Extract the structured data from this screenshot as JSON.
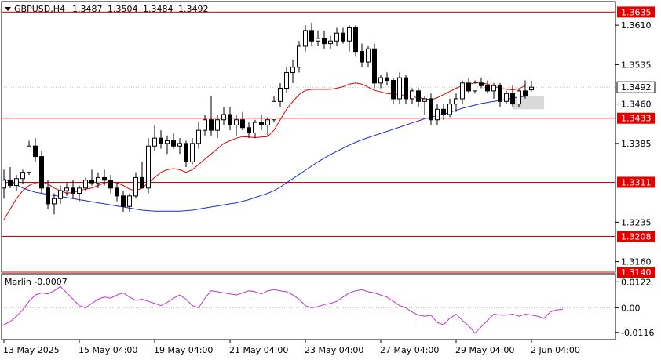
{
  "chart_data": [
    {
      "type": "candlestick",
      "symbol_header": "GBPUSD,H4",
      "ohlc_readout": [
        "1.3487",
        "1.3504",
        "1.3484",
        "1.3492"
      ],
      "y_axis_ticks": [
        "1.3610",
        "1.3535",
        "1.3460",
        "1.3385",
        "1.3235",
        "1.3160"
      ],
      "ylim": [
        1.314,
        1.3655
      ],
      "x_axis_ticks": [
        "13 May 2025",
        "15 May 04:00",
        "19 May 04:00",
        "21 May 04:00",
        "23 May 04:00",
        "27 May 04:00",
        "29 May 04:00",
        "2 Jun 04:00"
      ],
      "current_price": {
        "value": 1.3492,
        "label": "1.3492"
      },
      "horizontal_levels": [
        {
          "value": 1.3635,
          "label": "1.3635"
        },
        {
          "value": 1.3433,
          "label": "1.3433"
        },
        {
          "value": 1.3311,
          "label": "1.3311"
        },
        {
          "value": 1.3208,
          "label": "1.3208"
        },
        {
          "value": 1.314,
          "label": "1.3140"
        }
      ],
      "colors": {
        "levels": "#e00000",
        "fast_ma": "#e00000",
        "slow_ma": "#1a2ccc",
        "oscillator": "#bb33cc",
        "zone": "#d9d9d9"
      },
      "candles": [
        [
          1.33,
          1.3335,
          1.328,
          1.3315
        ],
        [
          1.3315,
          1.334,
          1.33,
          1.3305
        ],
        [
          1.3305,
          1.3325,
          1.3295,
          1.3318
        ],
        [
          1.3318,
          1.3335,
          1.3308,
          1.333
        ],
        [
          1.333,
          1.339,
          1.3325,
          1.338
        ],
        [
          1.338,
          1.3395,
          1.335,
          1.336
        ],
        [
          1.336,
          1.337,
          1.329,
          1.33
        ],
        [
          1.33,
          1.3315,
          1.326,
          1.327
        ],
        [
          1.327,
          1.329,
          1.325,
          1.328
        ],
        [
          1.328,
          1.3305,
          1.327,
          1.3295
        ],
        [
          1.3295,
          1.331,
          1.3285,
          1.33
        ],
        [
          1.33,
          1.3315,
          1.328,
          1.329
        ],
        [
          1.329,
          1.3305,
          1.3275,
          1.33
        ],
        [
          1.33,
          1.332,
          1.3295,
          1.3315
        ],
        [
          1.3315,
          1.3335,
          1.3305,
          1.331
        ],
        [
          1.331,
          1.333,
          1.33,
          1.332
        ],
        [
          1.332,
          1.3335,
          1.3305,
          1.3315
        ],
        [
          1.3315,
          1.3325,
          1.329,
          1.33
        ],
        [
          1.33,
          1.331,
          1.3275,
          1.3285
        ],
        [
          1.3285,
          1.3295,
          1.3255,
          1.3265
        ],
        [
          1.3265,
          1.329,
          1.3255,
          1.3285
        ],
        [
          1.3285,
          1.333,
          1.328,
          1.332
        ],
        [
          1.332,
          1.335,
          1.331,
          1.33
        ],
        [
          1.33,
          1.3395,
          1.329,
          1.338
        ],
        [
          1.338,
          1.342,
          1.337,
          1.3395
        ],
        [
          1.3395,
          1.341,
          1.3375,
          1.3385
        ],
        [
          1.3385,
          1.34,
          1.3365,
          1.339
        ],
        [
          1.339,
          1.3405,
          1.3375,
          1.338
        ],
        [
          1.338,
          1.3395,
          1.3365,
          1.3385
        ],
        [
          1.3385,
          1.339,
          1.334,
          1.335
        ],
        [
          1.335,
          1.3395,
          1.3345,
          1.3385
        ],
        [
          1.3385,
          1.3425,
          1.3375,
          1.341
        ],
        [
          1.341,
          1.344,
          1.34,
          1.343
        ],
        [
          1.343,
          1.3475,
          1.34,
          1.341
        ],
        [
          1.341,
          1.344,
          1.3395,
          1.343
        ],
        [
          1.343,
          1.3455,
          1.342,
          1.344
        ],
        [
          1.344,
          1.3455,
          1.341,
          1.342
        ],
        [
          1.342,
          1.344,
          1.34,
          1.343
        ],
        [
          1.343,
          1.3445,
          1.341,
          1.3415
        ],
        [
          1.3415,
          1.3425,
          1.3395,
          1.3405
        ],
        [
          1.3405,
          1.343,
          1.3395,
          1.3425
        ],
        [
          1.3425,
          1.344,
          1.341,
          1.342
        ],
        [
          1.342,
          1.3435,
          1.34,
          1.343
        ],
        [
          1.343,
          1.3475,
          1.3425,
          1.3465
        ],
        [
          1.3465,
          1.35,
          1.3455,
          1.349
        ],
        [
          1.349,
          1.353,
          1.348,
          1.352
        ],
        [
          1.352,
          1.3545,
          1.35,
          1.353
        ],
        [
          1.353,
          1.358,
          1.352,
          1.357
        ],
        [
          1.357,
          1.361,
          1.356,
          1.36
        ],
        [
          1.36,
          1.3615,
          1.357,
          1.358
        ],
        [
          1.358,
          1.36,
          1.357,
          1.3585
        ],
        [
          1.3585,
          1.36,
          1.3565,
          1.3575
        ],
        [
          1.3575,
          1.359,
          1.3565,
          1.358
        ],
        [
          1.358,
          1.3605,
          1.357,
          1.3595
        ],
        [
          1.3595,
          1.3605,
          1.3575,
          1.358
        ],
        [
          1.358,
          1.361,
          1.356,
          1.3605
        ],
        [
          1.3605,
          1.361,
          1.355,
          1.356
        ],
        [
          1.356,
          1.3575,
          1.353,
          1.354
        ],
        [
          1.354,
          1.357,
          1.353,
          1.3565
        ],
        [
          1.3565,
          1.3575,
          1.349,
          1.35
        ],
        [
          1.35,
          1.3515,
          1.349,
          1.351
        ],
        [
          1.351,
          1.352,
          1.3495,
          1.3505
        ],
        [
          1.3505,
          1.351,
          1.346,
          1.347
        ],
        [
          1.347,
          1.352,
          1.346,
          1.351
        ],
        [
          1.351,
          1.3515,
          1.346,
          1.347
        ],
        [
          1.347,
          1.349,
          1.346,
          1.3485
        ],
        [
          1.3485,
          1.349,
          1.3455,
          1.3465
        ],
        [
          1.3465,
          1.3475,
          1.344,
          1.347
        ],
        [
          1.347,
          1.348,
          1.342,
          1.343
        ],
        [
          1.343,
          1.346,
          1.342,
          1.345
        ],
        [
          1.345,
          1.346,
          1.343,
          1.344
        ],
        [
          1.344,
          1.347,
          1.3435,
          1.346
        ],
        [
          1.346,
          1.348,
          1.3445,
          1.347
        ],
        [
          1.347,
          1.3505,
          1.346,
          1.35
        ],
        [
          1.35,
          1.351,
          1.348,
          1.3485
        ],
        [
          1.3485,
          1.3505,
          1.348,
          1.35
        ],
        [
          1.35,
          1.351,
          1.349,
          1.3495
        ],
        [
          1.3495,
          1.3505,
          1.348,
          1.3485
        ],
        [
          1.3485,
          1.35,
          1.347,
          1.3495
        ],
        [
          1.3495,
          1.35,
          1.3455,
          1.3465
        ],
        [
          1.3465,
          1.3485,
          1.346,
          1.348
        ],
        [
          1.348,
          1.3495,
          1.3455,
          1.346
        ],
        [
          1.346,
          1.349,
          1.3455,
          1.3485
        ],
        [
          1.3485,
          1.3505,
          1.347,
          1.3475
        ],
        [
          1.3487,
          1.3504,
          1.3484,
          1.3492
        ]
      ],
      "fast_ma": [
        1.324,
        1.326,
        1.328,
        1.3295,
        1.3305,
        1.331,
        1.3312,
        1.3308,
        1.33,
        1.3295,
        1.329,
        1.3292,
        1.3295,
        1.3298,
        1.33,
        1.3305,
        1.331,
        1.3312,
        1.331,
        1.3305,
        1.3298,
        1.3295,
        1.33,
        1.331,
        1.332,
        1.333,
        1.3335,
        1.3337,
        1.3335,
        1.333,
        1.3335,
        1.3345,
        1.3355,
        1.3365,
        1.3375,
        1.3385,
        1.339,
        1.3395,
        1.3398,
        1.3397,
        1.3396,
        1.3397,
        1.3398,
        1.341,
        1.343,
        1.345,
        1.3465,
        1.3478,
        1.3486,
        1.3488,
        1.3488,
        1.3488,
        1.3488,
        1.349,
        1.3493,
        1.3498,
        1.35,
        1.3498,
        1.3492,
        1.3486,
        1.3483,
        1.348,
        1.3479,
        1.3478,
        1.3476,
        1.3474,
        1.3472,
        1.347,
        1.3468,
        1.3472,
        1.3478,
        1.3484,
        1.349,
        1.3495,
        1.3498,
        1.35,
        1.35,
        1.3498,
        1.3494,
        1.349,
        1.3488,
        1.3487,
        1.3489,
        1.3495
      ],
      "slow_ma": [
        1.3318,
        1.3312,
        1.3306,
        1.33,
        1.3296,
        1.3292,
        1.329,
        1.3288,
        1.3286,
        1.3284,
        1.3282,
        1.328,
        1.3278,
        1.3276,
        1.3274,
        1.3272,
        1.327,
        1.3268,
        1.3266,
        1.3264,
        1.3262,
        1.326,
        1.3258,
        1.3257,
        1.3256,
        1.3256,
        1.3256,
        1.3256,
        1.3256,
        1.3257,
        1.3258,
        1.326,
        1.3262,
        1.3264,
        1.3266,
        1.3268,
        1.327,
        1.3272,
        1.3275,
        1.3278,
        1.3282,
        1.3286,
        1.329,
        1.3295,
        1.3302,
        1.331,
        1.3318,
        1.3326,
        1.3334,
        1.3342,
        1.335,
        1.3357,
        1.3364,
        1.337,
        1.3376,
        1.3382,
        1.3387,
        1.3392,
        1.3396,
        1.34,
        1.3404,
        1.3408,
        1.3412,
        1.3416,
        1.342,
        1.3424,
        1.3428,
        1.3432,
        1.3435,
        1.3438,
        1.3441,
        1.3444,
        1.3448,
        1.3452,
        1.3455,
        1.3458,
        1.3461,
        1.3463,
        1.3465,
        1.3467,
        1.3469,
        1.3471,
        1.3473,
        1.3475
      ],
      "zone": {
        "x_from": 81,
        "x_to": 85,
        "y_from": 1.345,
        "y_to": 1.3475
      }
    },
    {
      "type": "line",
      "indicator_label": "Marlin -0.0007",
      "y_axis_ticks": [
        "0.0122",
        "0.00",
        "-0.0116"
      ],
      "ylim": [
        -0.015,
        0.016
      ],
      "zero_line": 0.0,
      "values": [
        -0.008,
        -0.0065,
        -0.004,
        -0.001,
        0.003,
        0.006,
        0.007,
        0.0065,
        0.008,
        0.01,
        0.007,
        0.004,
        0.001,
        0.0,
        0.002,
        0.004,
        0.005,
        0.0045,
        0.006,
        0.007,
        0.005,
        0.0035,
        0.004,
        0.003,
        0.002,
        0.001,
        0.0025,
        0.0045,
        0.006,
        0.004,
        0.001,
        0.0,
        0.0045,
        0.008,
        0.0075,
        0.007,
        0.0065,
        0.006,
        0.007,
        0.008,
        0.0075,
        0.0065,
        0.008,
        0.0085,
        0.008,
        0.0075,
        0.006,
        0.004,
        0.001,
        0.0,
        0.0005,
        0.0015,
        0.002,
        0.003,
        0.005,
        0.007,
        0.008,
        0.0085,
        0.0075,
        0.007,
        0.006,
        0.005,
        0.003,
        0.001,
        0.0,
        -0.002,
        -0.0035,
        -0.004,
        -0.0035,
        -0.007,
        -0.008,
        -0.005,
        -0.003,
        -0.006,
        -0.0085,
        -0.012,
        -0.009,
        -0.006,
        -0.003,
        -0.0035,
        -0.0035,
        -0.003,
        -0.004,
        -0.003,
        -0.0035,
        -0.004,
        -0.005,
        -0.002,
        -0.001,
        -0.0007
      ]
    }
  ]
}
